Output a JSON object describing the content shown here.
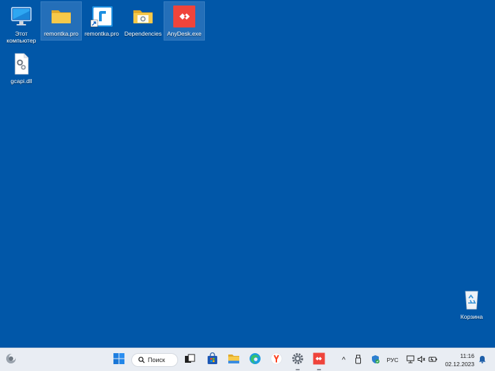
{
  "desktop": {
    "background_color": "#0157a8",
    "icons": [
      {
        "name": "this-pc",
        "label_line1": "Этот",
        "label_line2": "компьютер",
        "icon": "monitor-icon",
        "selected": false
      },
      {
        "name": "remontka-folder",
        "label": "remontka.pro",
        "icon": "folder-icon",
        "selected": true
      },
      {
        "name": "remontka-shortcut",
        "label": "remontka.pro",
        "icon": "remontka-app-icon",
        "selected": false
      },
      {
        "name": "dependencies-folder",
        "label": "Dependencies",
        "icon": "folder-gear-icon",
        "selected": false
      },
      {
        "name": "anydesk-exe",
        "label": "AnyDesk.exe",
        "icon": "anydesk-icon",
        "selected": true
      },
      {
        "name": "gcapi-dll",
        "label": "gcapi.dll",
        "icon": "dll-file-icon",
        "selected": false
      },
      {
        "name": "recycle-bin",
        "label": "Корзина",
        "icon": "recycle-bin-icon",
        "selected": false
      }
    ]
  },
  "taskbar": {
    "widgets_icon": "weather-widget-icon",
    "start_icon": "windows-start-icon",
    "search": {
      "label": "Поиск",
      "icon": "search-icon"
    },
    "apps": [
      {
        "name": "task-view",
        "icon": "task-view-icon",
        "running": false
      },
      {
        "name": "microsoft-store",
        "icon": "store-icon",
        "running": false
      },
      {
        "name": "file-explorer",
        "icon": "file-explorer-icon",
        "running": false
      },
      {
        "name": "edge",
        "icon": "edge-icon",
        "running": false
      },
      {
        "name": "yandex-browser",
        "icon": "yandex-browser-icon",
        "running": false
      },
      {
        "name": "settings",
        "icon": "settings-gear-icon",
        "running": true
      },
      {
        "name": "anydesk",
        "icon": "anydesk-icon",
        "running": true
      }
    ],
    "tray": {
      "chevron": "^",
      "language": "РУС",
      "time": "11:16",
      "date": "02.12.2023"
    },
    "colors": {
      "taskbar_bg": "#e9edf3",
      "anydesk_red": "#ef443b",
      "folder_yellow": "#f3c440"
    }
  }
}
